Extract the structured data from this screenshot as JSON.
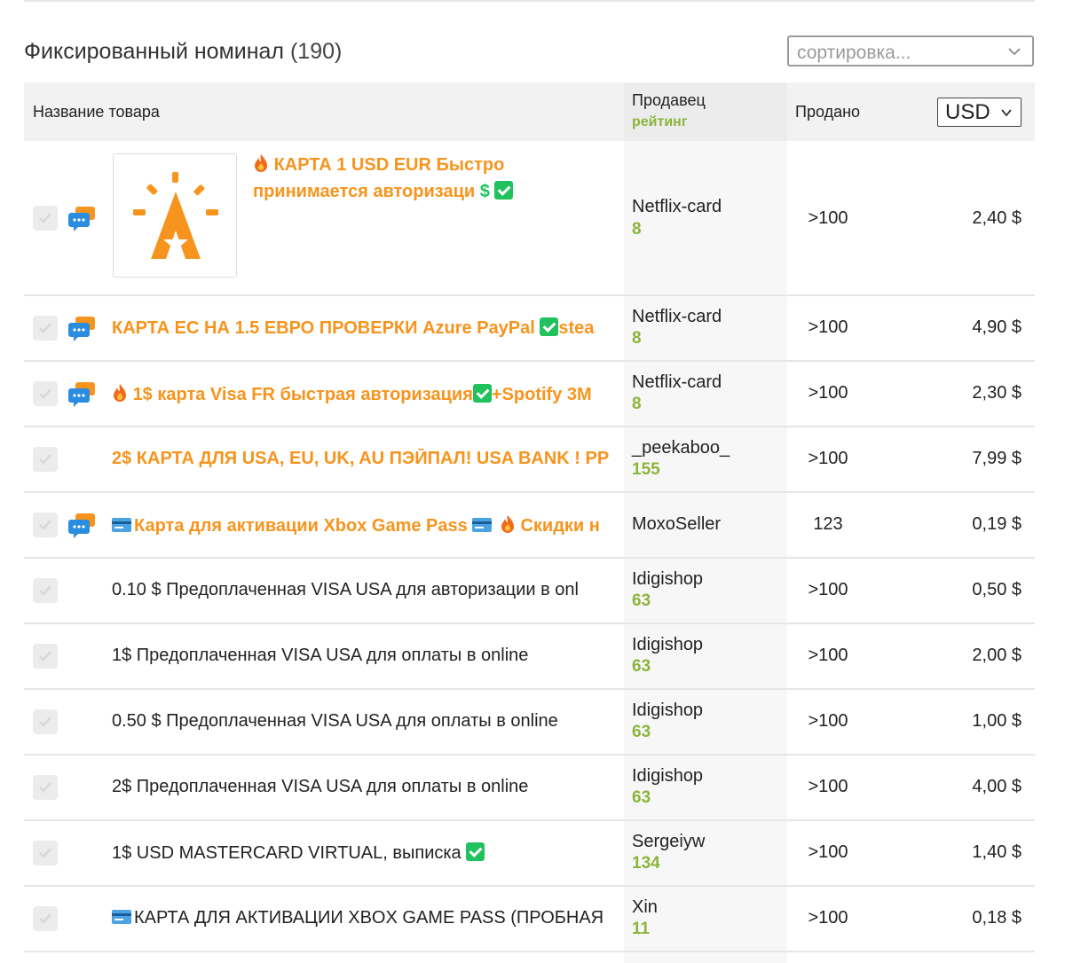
{
  "heading": {
    "title": "Фиксированный номинал",
    "count": "(190)"
  },
  "sort": {
    "placeholder": "сортировка..."
  },
  "table_header": {
    "name": "Название товара",
    "seller": "Продавец",
    "rating": "рейтинг",
    "sold": "Продано",
    "currency": "USD"
  },
  "colors": {
    "accent_orange": "#f7941d",
    "rating_green": "#8cb43c",
    "check_green": "#21c25e",
    "chat_blue": "#2a8de0"
  },
  "rows": [
    {
      "title_a": "КАРТА 1 USD EUR Быстро",
      "title_b": "принимается авторизаци",
      "dollar": "$",
      "seller": "Netflix-card",
      "rating": "8",
      "sold": ">100",
      "price": "2,40 $"
    },
    {
      "title": "КАРТА ЕС НА 1.5 ЕВРО ПРОВЕРКИ Azure PayPal",
      "title_tail": "stea",
      "seller": "Netflix-card",
      "rating": "8",
      "sold": ">100",
      "price": "4,90 $"
    },
    {
      "title": "1$ карта Visa FR быстрая авторизация",
      "title_tail": "+Spotify 3M",
      "seller": "Netflix-card",
      "rating": "8",
      "sold": ">100",
      "price": "2,30 $"
    },
    {
      "title": "2$ КАРТА ДЛЯ USA, EU, UK, AU ПЭЙПАЛ! USA BANK ! PP",
      "seller": "_peekaboo_",
      "rating": "155",
      "sold": ">100",
      "price": "7,99 $"
    },
    {
      "title": "Карта для активации Xbox Game Pass",
      "title_tail": "Скидки н",
      "seller": "MoxoSeller",
      "rating": "",
      "sold": "123",
      "price": "0,19 $"
    },
    {
      "title": "0.10 $ Предоплаченная VISA USA для авторизации в onl",
      "seller": "Idigishop",
      "rating": "63",
      "sold": ">100",
      "price": "0,50 $"
    },
    {
      "title": "1$ Предоплаченная VISA USA для оплаты в online",
      "seller": "Idigishop",
      "rating": "63",
      "sold": ">100",
      "price": "2,00 $"
    },
    {
      "title": "0.50 $ Предоплаченная VISA USA для оплаты в online",
      "seller": "Idigishop",
      "rating": "63",
      "sold": ">100",
      "price": "1,00 $"
    },
    {
      "title": "2$ Предоплаченная VISA USA для оплаты в online",
      "seller": "Idigishop",
      "rating": "63",
      "sold": ">100",
      "price": "4,00 $"
    },
    {
      "title": "1$ USD MASTERCARD VIRTUAL, выписка",
      "seller": "Sergeiyw",
      "rating": "134",
      "sold": ">100",
      "price": "1,40 $"
    },
    {
      "title": "КАРТА ДЛЯ АКТИВАЦИИ XBOX GAME PASS (ПРОБНАЯ",
      "seller": "Xin",
      "rating": "11",
      "sold": ">100",
      "price": "0,18 $"
    }
  ]
}
